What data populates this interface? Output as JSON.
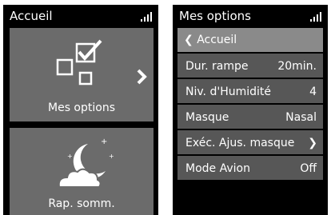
{
  "home_screen": {
    "title": "Accueil",
    "tiles": [
      {
        "label": "Mes options",
        "icon": "options-checkbox-icon"
      },
      {
        "label": "Rap. somm.",
        "icon": "moon-cloud-icon"
      }
    ]
  },
  "options_screen": {
    "title": "Mes options",
    "back_label": "Accueil",
    "rows": [
      {
        "label": "Dur. rampe",
        "value": "20min."
      },
      {
        "label": "Niv. d'Humidité",
        "value": "4"
      },
      {
        "label": "Masque",
        "value": "Nasal"
      },
      {
        "label": "Exéc. Ajus. masque",
        "value": ""
      },
      {
        "label": "Mode Avion",
        "value": "Off"
      }
    ]
  },
  "colors": {
    "screen_bg": "#000000",
    "tile_bg": "#6b6b6b",
    "row_bg": "#575757",
    "back_row_bg": "#8a8a8a",
    "text": "#ffffff"
  }
}
